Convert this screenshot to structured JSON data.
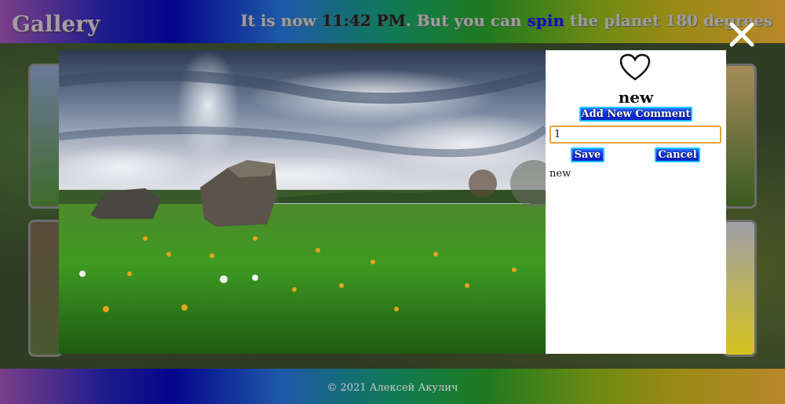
{
  "header": {
    "title": "Gallery",
    "clock": {
      "prefix": "It is now ",
      "time": "11:42 PM",
      "middle": ". But you can ",
      "link": "spin",
      "suffix": " the planet 180 degrees"
    }
  },
  "modal": {
    "photo_title": "new",
    "add_comment_label": "Add New Comment",
    "comment_input_value": "1",
    "save_label": "Save",
    "cancel_label": "Cancel",
    "comments": [
      "new"
    ],
    "icons": {
      "close": "close-icon",
      "like": "heart-icon"
    }
  },
  "footer": {
    "text": "© 2021 Алексей Акулич"
  },
  "colors": {
    "button_blue": "#1030e0",
    "button_border": "#18c8ff",
    "input_focus": "#e8a33a",
    "header_text": "#a89aa8"
  }
}
